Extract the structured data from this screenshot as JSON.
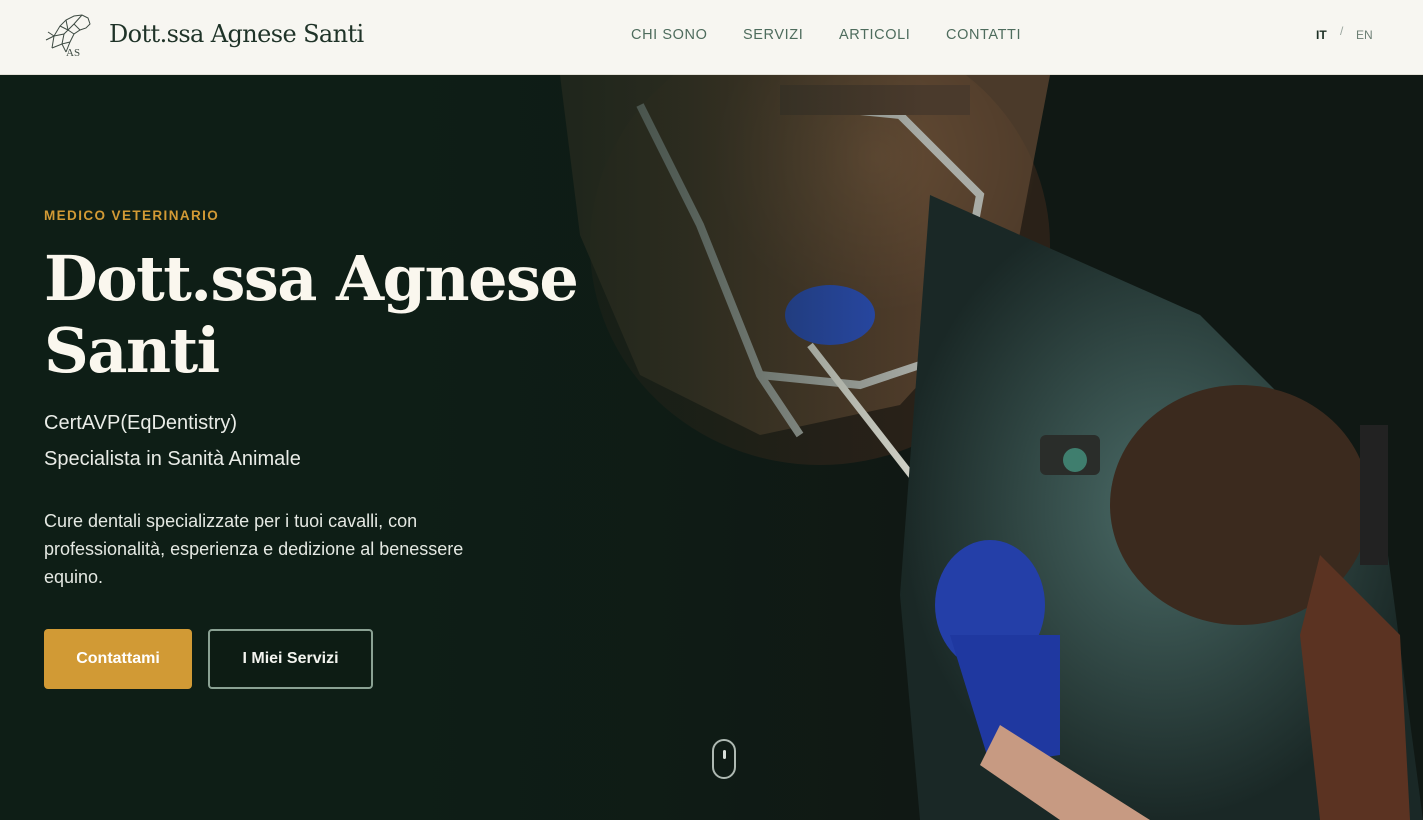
{
  "nav": {
    "brand": "Dott.ssa Agnese Santi",
    "links": [
      "CHI SONO",
      "SERVIZI",
      "ARTICOLI",
      "CONTATTI"
    ],
    "lang_active": "IT",
    "lang_separator": "/",
    "lang_other": "EN"
  },
  "hero": {
    "eyebrow": "MEDICO VETERINARIO",
    "title": "Dott.ssa Agnese Santi",
    "credential_1": "CertAVP(EqDentistry)",
    "credential_2": "Specialista in Sanità Animale",
    "description": "Cure dentali specializzate per i tuoi cavalli, con professionalità, esperienza e dedizione al benessere equino.",
    "primary_button": "Contattami",
    "secondary_button": "I Miei Servizi"
  },
  "colors": {
    "accent": "#d19a35",
    "nav_background": "#f7f6f1",
    "hero_dark": "#0e1e16",
    "brand_text": "#1f3328"
  },
  "icons": {
    "logo": "horse-head-logo-icon",
    "scroll": "mouse-scroll-icon"
  }
}
